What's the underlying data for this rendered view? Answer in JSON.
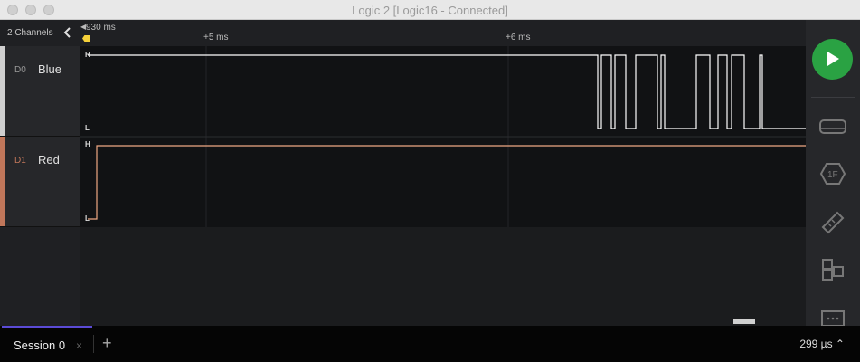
{
  "window": {
    "title": "Logic 2 [Logic16 - Connected]"
  },
  "channels_header": {
    "count_label": "2 Channels"
  },
  "timeline": {
    "start_label": "930 ms",
    "ticks": [
      "+5 ms",
      "+6 ms"
    ]
  },
  "channels": [
    {
      "id": "D0",
      "name": "Blue",
      "accent": "#cfcfcf",
      "high_label": "H",
      "low_label": "L"
    },
    {
      "id": "D1",
      "name": "Red",
      "accent": "#c0765a",
      "high_label": "H",
      "low_label": "L"
    }
  ],
  "colors": {
    "d0_trace": "#ffffff",
    "d1_trace": "#f0a883",
    "play": "#2aa243",
    "marker": "#f5d13a",
    "session_tab_accent": "#5b4bd6"
  },
  "sidebar": {
    "icons": [
      "play-icon",
      "analyzers-icon",
      "trigger-icon",
      "measure-icon",
      "extensions-icon",
      "comment-icon"
    ]
  },
  "bottombar": {
    "session_label": "Session 0",
    "close_glyph": "×",
    "add_glyph": "+",
    "timing_readout": "299 µs ⌃"
  }
}
